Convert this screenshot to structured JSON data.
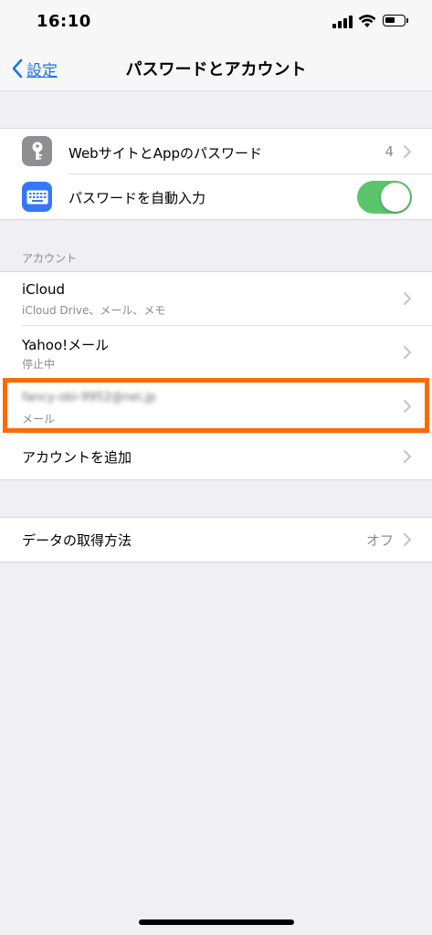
{
  "status_bar": {
    "time": "16:10"
  },
  "nav": {
    "back_label": "設定",
    "title": "パスワードとアカウント"
  },
  "passwords_group": {
    "website_passwords": {
      "label": "WebサイトとAppのパスワード",
      "value": "4",
      "icon": "key-icon"
    },
    "autofill": {
      "label": "パスワードを自動入力",
      "icon": "keyboard-icon",
      "enabled": true
    }
  },
  "accounts_section": {
    "header": "アカウント",
    "items": [
      {
        "title": "iCloud",
        "subtitle": "iCloud Drive、メール、メモ"
      },
      {
        "title": "Yahoo!メール",
        "subtitle": "停止中"
      },
      {
        "title": "fancy-obi-9952@nei.jp",
        "subtitle": "メール"
      }
    ],
    "add_account": "アカウントを追加"
  },
  "fetch_group": {
    "label": "データの取得方法",
    "value": "オフ"
  },
  "colors": {
    "accent_blue": "#1a73e8",
    "toggle_on": "#5cc46a",
    "highlight_orange": "#ff6a00",
    "key_icon_bg": "#8e8e93",
    "keyboard_icon_bg": "#3478f6"
  }
}
